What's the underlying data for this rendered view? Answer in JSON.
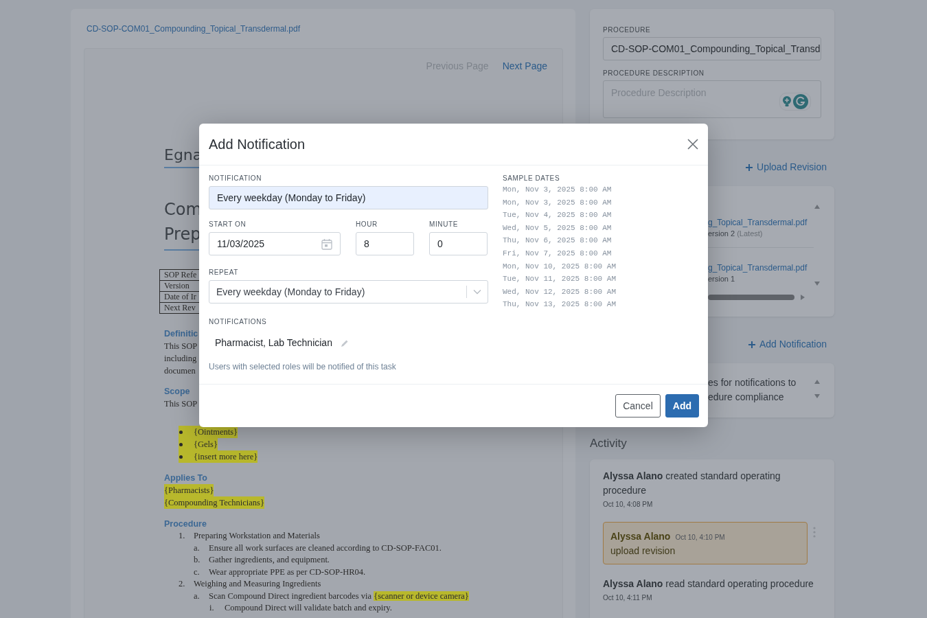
{
  "document_panel": {
    "file_name": "CD-SOP-COM01_Compounding_Topical_Transdermal.pdf",
    "pager": [
      {
        "label": "Previous Page",
        "disabled": true
      },
      {
        "label": "Next Page",
        "disabled": false
      }
    ],
    "document": {
      "title": "Egna",
      "heading_lines": [
        "Com",
        "Prep"
      ],
      "info_table": [
        "SOP Refe",
        "Version",
        "Date of Ir",
        "Next Rev"
      ],
      "definitions": {
        "heading": "Definitic",
        "lines": [
          "This SOP",
          "including",
          "documen"
        ]
      },
      "scope": {
        "heading": "Scope",
        "lines": [
          "This SOP"
        ],
        "bullets": [
          {
            "text": "{Ointments}",
            "highlighted": true
          },
          {
            "text": "{Gels}",
            "highlighted": true
          },
          {
            "text": "{insert more here}",
            "highlighted": true
          }
        ]
      },
      "applies_to": {
        "heading": "Applies To",
        "lines": [
          {
            "text": "{Pharmacists}",
            "highlighted": true
          },
          {
            "text": "{Compounding Technicians}",
            "highlighted": true
          }
        ]
      },
      "procedure": {
        "heading": "Procedure",
        "steps": [
          {
            "marker": "1.",
            "segments": [
              {
                "text": "Preparing Workstation and Materials",
                "highlighted": false
              }
            ],
            "children": [
              {
                "marker": "a.",
                "segments": [
                  {
                    "text": "Ensure all work surfaces are cleaned according to CD-SOP-FAC01.",
                    "highlighted": false
                  }
                ]
              },
              {
                "marker": "b.",
                "segments": [
                  {
                    "text": "Gather ingredients, and equipment.",
                    "highlighted": false
                  }
                ]
              },
              {
                "marker": "c.",
                "segments": [
                  {
                    "text": "Wear appropriate PPE as per CD-SOP-HR04.",
                    "highlighted": false
                  }
                ]
              }
            ]
          },
          {
            "marker": "2.",
            "segments": [
              {
                "text": "Weighing and Measuring Ingredients",
                "highlighted": false
              }
            ],
            "children": [
              {
                "marker": "a.",
                "segments": [
                  {
                    "text": "Scan Compound Direct ingredient barcodes via ",
                    "highlighted": false
                  },
                  {
                    "text": "{scanner or device camera}",
                    "highlighted": true
                  }
                ],
                "children": [
                  {
                    "marker": "i.",
                    "segments": [
                      {
                        "text": "Compound Direct will validate batch and expiry.",
                        "highlighted": false
                      }
                    ]
                  }
                ]
              }
            ]
          }
        ]
      }
    }
  },
  "procedure_panel": {
    "procedure_label": "PROCEDURE",
    "procedure_value": "CD-SOP-COM01_Compounding_Topical_Transd",
    "description_label": "PROCEDURE DESCRIPTION",
    "description_placeholder": "Procedure Description"
  },
  "upload_revision": "Upload Revision",
  "revisions": [
    {
      "file": "g_Topical_Transdermal.pdf",
      "version": "ersion 2",
      "note": "(Latest)"
    },
    {
      "file": "g_Topical_Transdermal.pdf",
      "version": "ersion 1"
    }
  ],
  "add_notification": "Add Notification",
  "notification_lines": [
    "es for notifications to",
    "edure compliance"
  ],
  "activity": {
    "heading": "Activity",
    "entries": [
      {
        "kind": "event",
        "text": "**Alyssa Alano** created standard operating procedure",
        "time": "Oct 10, 4:08 PM"
      },
      {
        "kind": "comment",
        "actor": "Alyssa Alano",
        "time": "Oct 10, 4:10 PM",
        "body": "upload revision"
      },
      {
        "kind": "event",
        "text": "**Alyssa Alano** read standard operating procedure",
        "time": "Oct 10, 4:11 PM"
      }
    ]
  },
  "modal": {
    "title": "Add Notification",
    "notification": {
      "label": "NOTIFICATION",
      "value": "Every weekday (Monday to Friday)"
    },
    "start_on": {
      "label": "START ON",
      "value": "11/03/2025"
    },
    "hour": {
      "label": "HOUR",
      "value": "8"
    },
    "minute": {
      "label": "MINUTE",
      "value": "0"
    },
    "repeat": {
      "label": "REPEAT",
      "value": "Every weekday (Monday to Friday)"
    },
    "notifications": {
      "label": "NOTIFICATIONS",
      "roles": "Pharmacist, Lab Technician",
      "hint": "Users with selected roles will be notified of this task"
    },
    "sample_dates": {
      "label": "SAMPLE DATES",
      "dates": [
        "Mon, Nov 3, 2025 8:00 AM",
        "Mon, Nov 3, 2025 8:00 AM",
        "Tue, Nov 4, 2025 8:00 AM",
        "Wed, Nov 5, 2025 8:00 AM",
        "Thu, Nov 6, 2025 8:00 AM",
        "Fri, Nov 7, 2025 8:00 AM",
        "Mon, Nov 10, 2025 8:00 AM",
        "Tue, Nov 11, 2025 8:00 AM",
        "Wed, Nov 12, 2025 8:00 AM",
        "Thu, Nov 13, 2025 8:00 AM"
      ]
    },
    "buttons": [
      {
        "label": "Cancel",
        "kind": "secondary"
      },
      {
        "label": "Add",
        "kind": "primary"
      }
    ]
  }
}
